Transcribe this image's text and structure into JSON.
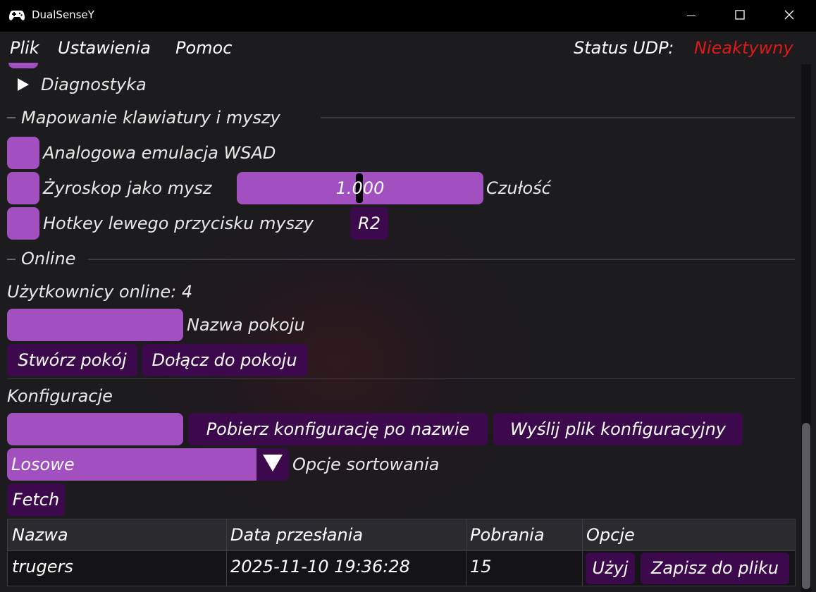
{
  "window": {
    "title": "DualSenseY",
    "icon": "gamepad-icon"
  },
  "menu": {
    "items": [
      "Plik",
      "Ustawienia",
      "Pomoc"
    ],
    "status_label": "Status UDP:",
    "status_value": "Nieaktywny",
    "status_color": "#e01818"
  },
  "diagnostics": {
    "label": "Diagnostyka",
    "expanded": false
  },
  "mapping": {
    "section_title": "Mapowanie klawiatury i myszy",
    "wsad_label": "Analogowa emulacja WSAD",
    "wsad_checked": false,
    "gyro_label": "Żyroskop jako mysz",
    "gyro_checked": false,
    "sensitivity_value": "1.000",
    "sensitivity_label": "Czułość",
    "hotkey_label": "Hotkey lewego przycisku myszy",
    "hotkey_checked": false,
    "hotkey_button": "R2"
  },
  "online": {
    "section_title": "Online",
    "users_online": "Użytkownicy online: 4",
    "room_name_value": "",
    "room_name_label": "Nazwa pokoju",
    "create_room": "Stwórz pokój",
    "join_room": "Dołącz do pokoju"
  },
  "configs": {
    "title": "Konfiguracje",
    "name_input_value": "",
    "fetch_by_name": "Pobierz konfigurację po nazwie",
    "upload_file": "Wyślij plik konfiguracyjny",
    "sort_selected": "Losowe",
    "sort_label": "Opcje sortowania",
    "fetch_button": "Fetch",
    "table": {
      "columns": [
        "Nazwa",
        "Data przesłania",
        "Pobrania",
        "Opcje"
      ],
      "rows": [
        {
          "name": "trugers",
          "date": "2025-11-10 19:36:28",
          "downloads": "15",
          "use_button": "Użyj",
          "save_button": "Zapisz do pliku"
        }
      ]
    }
  },
  "colors": {
    "accent": "#a24fc0",
    "button": "#3c0a4c",
    "background": "#1c1b1e",
    "titlebar": "#000000"
  }
}
